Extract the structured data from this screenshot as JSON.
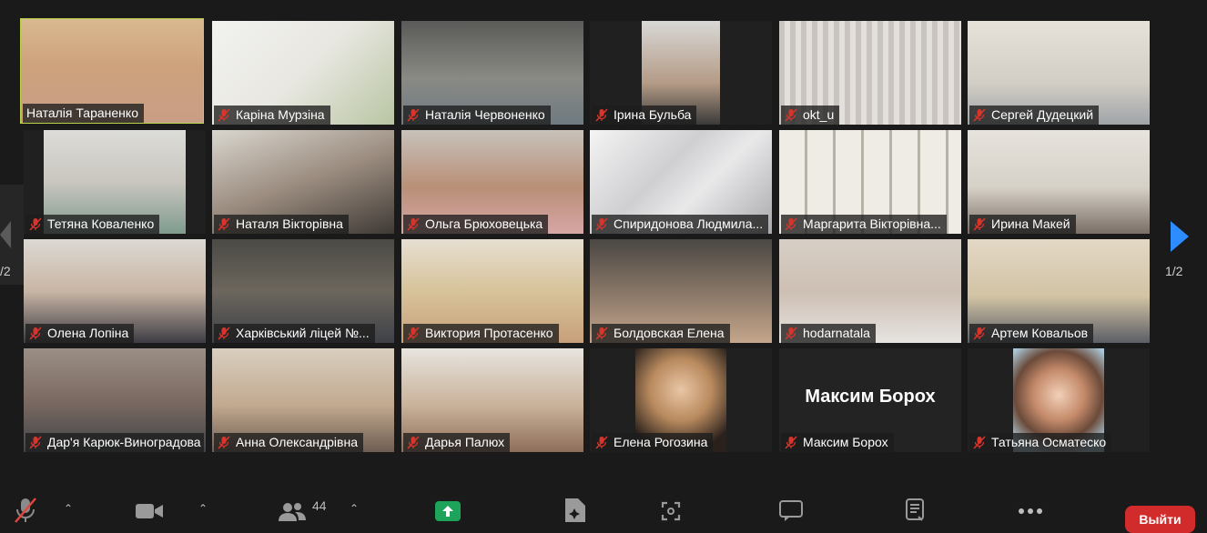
{
  "gallery": {
    "tiles": [
      {
        "name": "Наталія Тараненко",
        "muted": false,
        "active": true
      },
      {
        "name": "Каріна Мурзіна",
        "muted": true
      },
      {
        "name": "Наталія Червоненко",
        "muted": true
      },
      {
        "name": "Ірина Бульба",
        "muted": true
      },
      {
        "name": "okt_u",
        "muted": true
      },
      {
        "name": "Сергей Дудецкий",
        "muted": true
      },
      {
        "name": "Тетяна Коваленко",
        "muted": true
      },
      {
        "name": "Наталя Вікторівна",
        "muted": true
      },
      {
        "name": "Ольга Брюховецька",
        "muted": true
      },
      {
        "name": "Спиридонова Людмила...",
        "muted": true
      },
      {
        "name": "Маргарита Вікторівна...",
        "muted": true
      },
      {
        "name": "Ирина Макей",
        "muted": true
      },
      {
        "name": "Олена Лопіна",
        "muted": true
      },
      {
        "name": "Харківський ліцей №...",
        "muted": true
      },
      {
        "name": "Виктория   Протасенко",
        "muted": true
      },
      {
        "name": "Болдовская Елена",
        "muted": true
      },
      {
        "name": "hodarnatala",
        "muted": true
      },
      {
        "name": "Артем Ковальов",
        "muted": true
      },
      {
        "name": "Дар'я Карюк-Виноградова",
        "muted": true
      },
      {
        "name": "Анна Олександрівна",
        "muted": true
      },
      {
        "name": "Дарья Палюх",
        "muted": true
      },
      {
        "name": "Елена Рогозина",
        "muted": true
      },
      {
        "name": "Максим Борох",
        "muted": true,
        "video_off": true
      },
      {
        "name": "Татьяна Осматеско",
        "muted": true
      }
    ],
    "big_name": "Максим Борох",
    "page_left": "/2",
    "page_right": "1/2"
  },
  "toolbar": {
    "participants_count": "44",
    "leave_label": "Выйти",
    "icons": [
      "mic-muted-icon",
      "video-camera-icon",
      "participants-icon",
      "share-screen-icon",
      "whiteboard-icon",
      "apps-icon",
      "chat-icon",
      "notes-icon",
      "more-icon"
    ]
  },
  "colors": {
    "background": "#1a1a1a",
    "active_speaker": "#b9d24a",
    "mute_red": "#d9342b",
    "share_green": "#1ea35a",
    "leave_red": "#d12b2b",
    "arrow_blue": "#2d8cff"
  }
}
